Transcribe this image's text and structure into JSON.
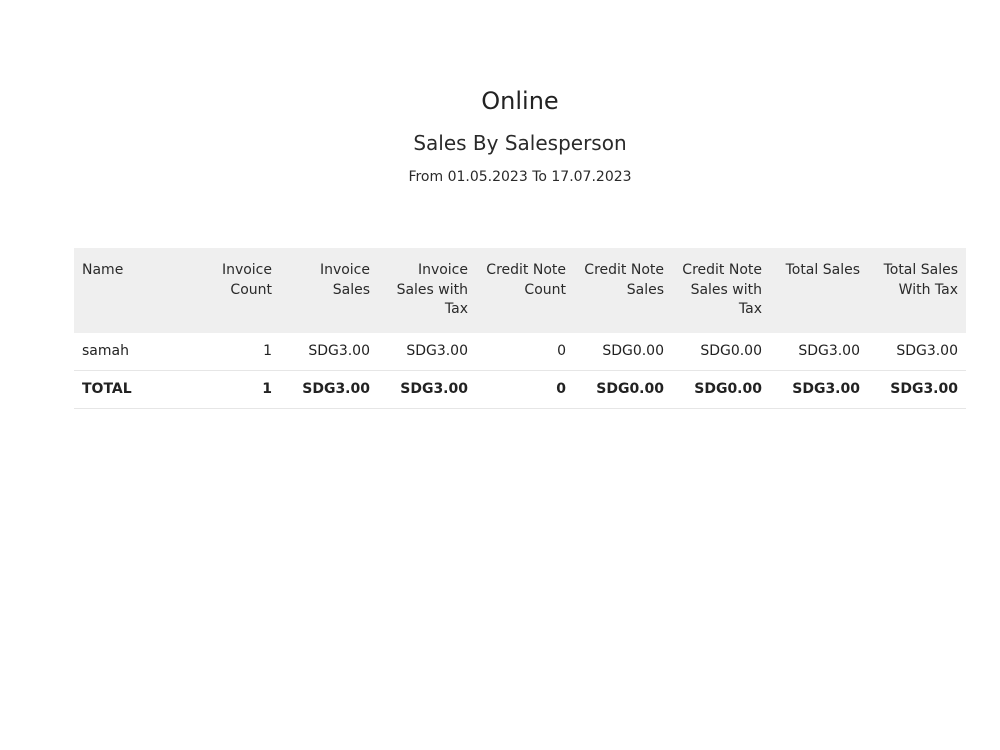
{
  "report": {
    "title": "Online",
    "subtitle": "Sales By Salesperson",
    "date_range": "From 01.05.2023 To 17.07.2023"
  },
  "table": {
    "headers": [
      "Name",
      "Invoice Count",
      "Invoice Sales",
      "Invoice Sales with Tax",
      "Credit Note Count",
      "Credit Note Sales",
      "Credit Note Sales with Tax",
      "Total Sales",
      "Total Sales With Tax"
    ],
    "rows": [
      [
        "samah",
        "1",
        "SDG3.00",
        "SDG3.00",
        "0",
        "SDG0.00",
        "SDG0.00",
        "SDG3.00",
        "SDG3.00"
      ]
    ],
    "total": [
      "TOTAL",
      "1",
      "SDG3.00",
      "SDG3.00",
      "0",
      "SDG0.00",
      "SDG0.00",
      "SDG3.00",
      "SDG3.00"
    ]
  }
}
